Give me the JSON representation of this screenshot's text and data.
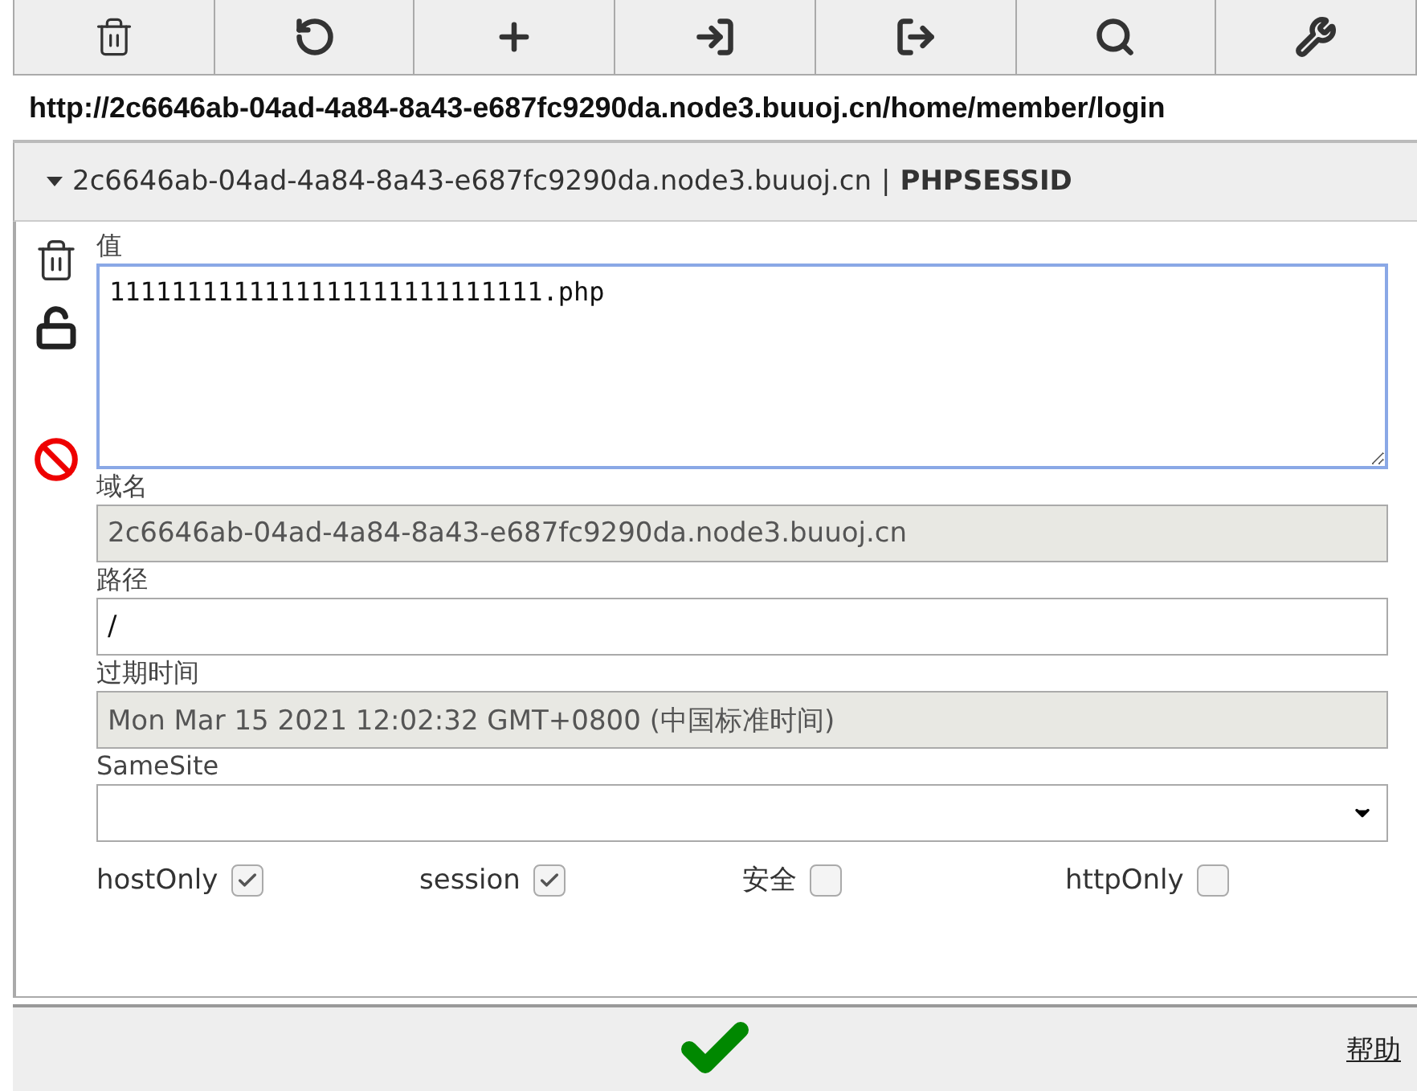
{
  "toolbar": {
    "buttons": [
      {
        "kind": "trash"
      },
      {
        "kind": "undo"
      },
      {
        "kind": "plus"
      },
      {
        "kind": "import"
      },
      {
        "kind": "export"
      },
      {
        "kind": "search"
      },
      {
        "kind": "wrench"
      }
    ]
  },
  "url": "http://2c6646ab-04ad-4a84-8a43-e687fc9290da.node3.buuoj.cn/home/member/login",
  "cookie_header": {
    "expanded": true,
    "domain": "2c6646ab-04ad-4a84-8a43-e687fc9290da.node3.buuoj.cn",
    "separator": "|",
    "name": "PHPSESSID"
  },
  "side_actions": [
    {
      "kind": "trash"
    },
    {
      "kind": "unlock"
    },
    {
      "kind": "block"
    }
  ],
  "fields": [
    {
      "label": "值",
      "kind": "textarea",
      "value": "1111111111111111111111111111.php"
    },
    {
      "label": "域名",
      "kind": "input",
      "value": "2c6646ab-04ad-4a84-8a43-e687fc9290da.node3.buuoj.cn",
      "disabled": true
    },
    {
      "label": "路径",
      "kind": "input",
      "value": "/",
      "disabled": false
    },
    {
      "label": "过期时间",
      "kind": "input",
      "value": "Mon Mar 15 2021 12:02:32 GMT+0800 (中国标准时间)",
      "disabled": true
    },
    {
      "label": "SameSite",
      "kind": "select"
    }
  ],
  "checkboxes": [
    {
      "label": "hostOnly",
      "checked": true
    },
    {
      "label": "session",
      "checked": true
    },
    {
      "label": "安全",
      "checked": false
    },
    {
      "label": "httpOnly",
      "checked": false
    }
  ],
  "footer": {
    "help": "帮助"
  }
}
